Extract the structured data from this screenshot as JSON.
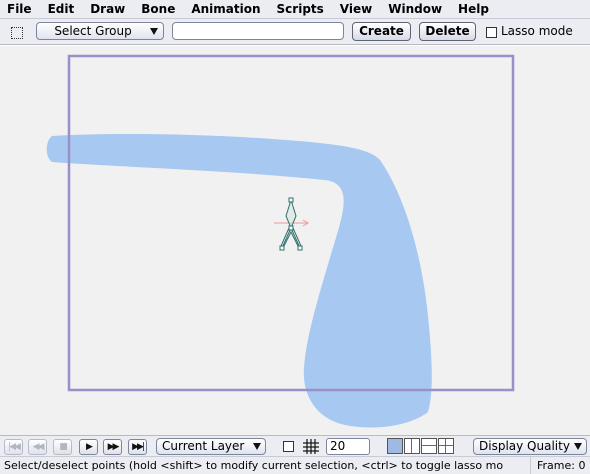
{
  "menu": {
    "items": [
      "File",
      "Edit",
      "Draw",
      "Bone",
      "Animation",
      "Scripts",
      "View",
      "Window",
      "Help"
    ]
  },
  "toolbar": {
    "tool_icon": "marquee-select-icon",
    "group_select": "Select Group",
    "group_name_value": "",
    "create_label": "Create",
    "delete_label": "Delete",
    "lasso_label": "Lasso mode",
    "lasso_checked": false
  },
  "canvas": {
    "background": "#f1f1f1",
    "frame_border_color": "#9a8fc8",
    "shape_fill_color": "#a6c8f1",
    "bone_color": "#2f6f6a",
    "axis_color": "#e89a9a"
  },
  "timeline": {
    "controls": [
      "rewind-to-start-icon",
      "step-back-icon",
      "stop-icon",
      "play-icon",
      "step-forward-icon",
      "forward-to-end-icon"
    ],
    "layer_select": "Current Layer",
    "onion_skin_checked": false,
    "grid_icon": "grid-icon",
    "fps_value": "20",
    "view_modes": [
      "single-view-icon",
      "split-vertical-icon",
      "split-horizontal-icon",
      "quad-view-icon"
    ],
    "quality_select": "Display Quality"
  },
  "status": {
    "message": "Select/deselect points (hold <shift> to modify current selection, <ctrl> to toggle lasso mo",
    "frame": "Frame: 0"
  }
}
